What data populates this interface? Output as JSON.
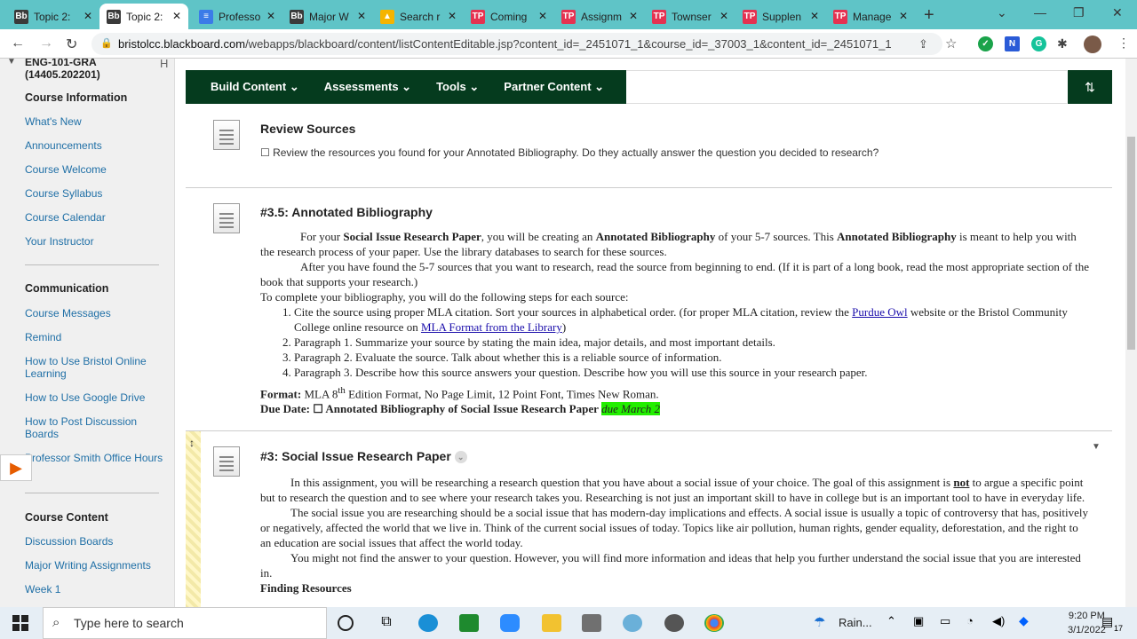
{
  "tabs": [
    {
      "icon": "bb",
      "title": "Topic 2:"
    },
    {
      "icon": "bb",
      "title": "Topic 2:"
    },
    {
      "icon": "doc",
      "title": "Professo"
    },
    {
      "icon": "bb",
      "title": "Major W"
    },
    {
      "icon": "drive",
      "title": "Search r"
    },
    {
      "icon": "tp",
      "title": "Coming"
    },
    {
      "icon": "tp",
      "title": "Assignm"
    },
    {
      "icon": "tp",
      "title": "Townser"
    },
    {
      "icon": "tp",
      "title": "Supplen"
    },
    {
      "icon": "tp",
      "title": "Manage"
    }
  ],
  "url": {
    "host": "bristolcc.blackboard.com",
    "path": "/webapps/blackboard/content/listContentEditable.jsp?content_id=_2451071_1&course_id=_37003_1&content_id=_2451071_1"
  },
  "sidebar": {
    "course_code": "ENG-101-GRA (14405.202201)",
    "course_info": "Course Information",
    "links1": [
      "What's New",
      "Announcements",
      "Course Welcome",
      "Course Syllabus",
      "Course Calendar",
      "Your Instructor"
    ],
    "communication": "Communication",
    "links2": [
      "Course Messages",
      "Remind",
      "How to Use Bristol Online Learning",
      "How to Use Google Drive",
      "How to Post Discussion Boards",
      "Professor Smith Office Hours"
    ],
    "course_content": "Course Content",
    "links3": [
      "Discussion Boards",
      "Major Writing Assignments",
      "Week 1"
    ]
  },
  "toolbar": {
    "build": "Build Content",
    "assessments": "Assessments",
    "tools": "Tools",
    "partner": "Partner Content"
  },
  "items": {
    "review": {
      "title": "Review Sources",
      "desc": "☐ Review the resources you found for your Annotated Bibliography. Do they actually answer the question you decided to research?"
    },
    "annotated": {
      "title": "#3.5: Annotated Bibliography",
      "p1_a": "For your ",
      "p1_b": "Social Issue Research Paper",
      "p1_c": ", you will be creating an ",
      "p1_d": "Annotated Bibliography",
      "p1_e": " of your 5-7 sources. This ",
      "p1_f": "Annotated Bibliography",
      "p1_g": " is meant to help you with the research process of your paper. Use the library databases to search for these sources.",
      "p2": "After you have found the 5-7 sources that you want to research, read the source from beginning to end. (If it is part of a long book, read the most appropriate section of the book that supports your research.)",
      "p3": "To complete your bibliography, you will do the following steps for each source:",
      "li1_a": "Cite the source using proper MLA citation. Sort your sources in alphabetical order. (for proper MLA citation, review the ",
      "li1_link1": "Purdue Owl",
      "li1_b": " website or the Bristol Community College online resource on ",
      "li1_link2": "MLA Format from the Library",
      "li1_c": ")",
      "li2": "Paragraph 1. Summarize your source by stating the main idea, major details, and most important details.",
      "li3": "Paragraph 2. Evaluate the source. Talk about whether this is a reliable source of information.",
      "li4": "Paragraph 3. Describe how this source answers your question. Describe how you will use this source in your research paper.",
      "format_label": "Format:",
      "format_a": " MLA 8",
      "format_sup": "th",
      "format_b": " Edition Format, No Page Limit, 12 Point Font, Times New Roman.",
      "due_label": "Due Date: ☐ Annotated Bibliography",
      "due_mid": " of ",
      "due_paper": "Social Issue Research Paper",
      "due_hl": "due March 2"
    },
    "paper": {
      "title": "#3: Social Issue Research Paper",
      "p1_a": "In this assignment, you will be researching a research question that you have about a social issue of your choice. The goal of this assignment is ",
      "p1_not": "not",
      "p1_b": " to argue a specific point but to research the question and to see where your research takes you. Researching is not just an important skill to have in college but is an important tool to have in everyday life.",
      "p2": "The social issue you are researching should be a social issue that has modern-day implications and effects. A social issue is usually a topic of controversy that has, positively or negatively, affected the world that we live in. Think of the current social issues of today. Topics like air pollution, human rights, gender equality, deforestation, and the right to an education are social issues that affect the world today.",
      "p3": "You might not find the answer to your question. However, you will find more information and ideas that help you further understand the social issue that you are interested in.",
      "finding": "Finding Resources"
    }
  },
  "taskbar": {
    "search_placeholder": "Type here to search",
    "weather": "Rain...",
    "time": "9:20 PM",
    "date": "3/1/2022",
    "notif_count": "17"
  }
}
